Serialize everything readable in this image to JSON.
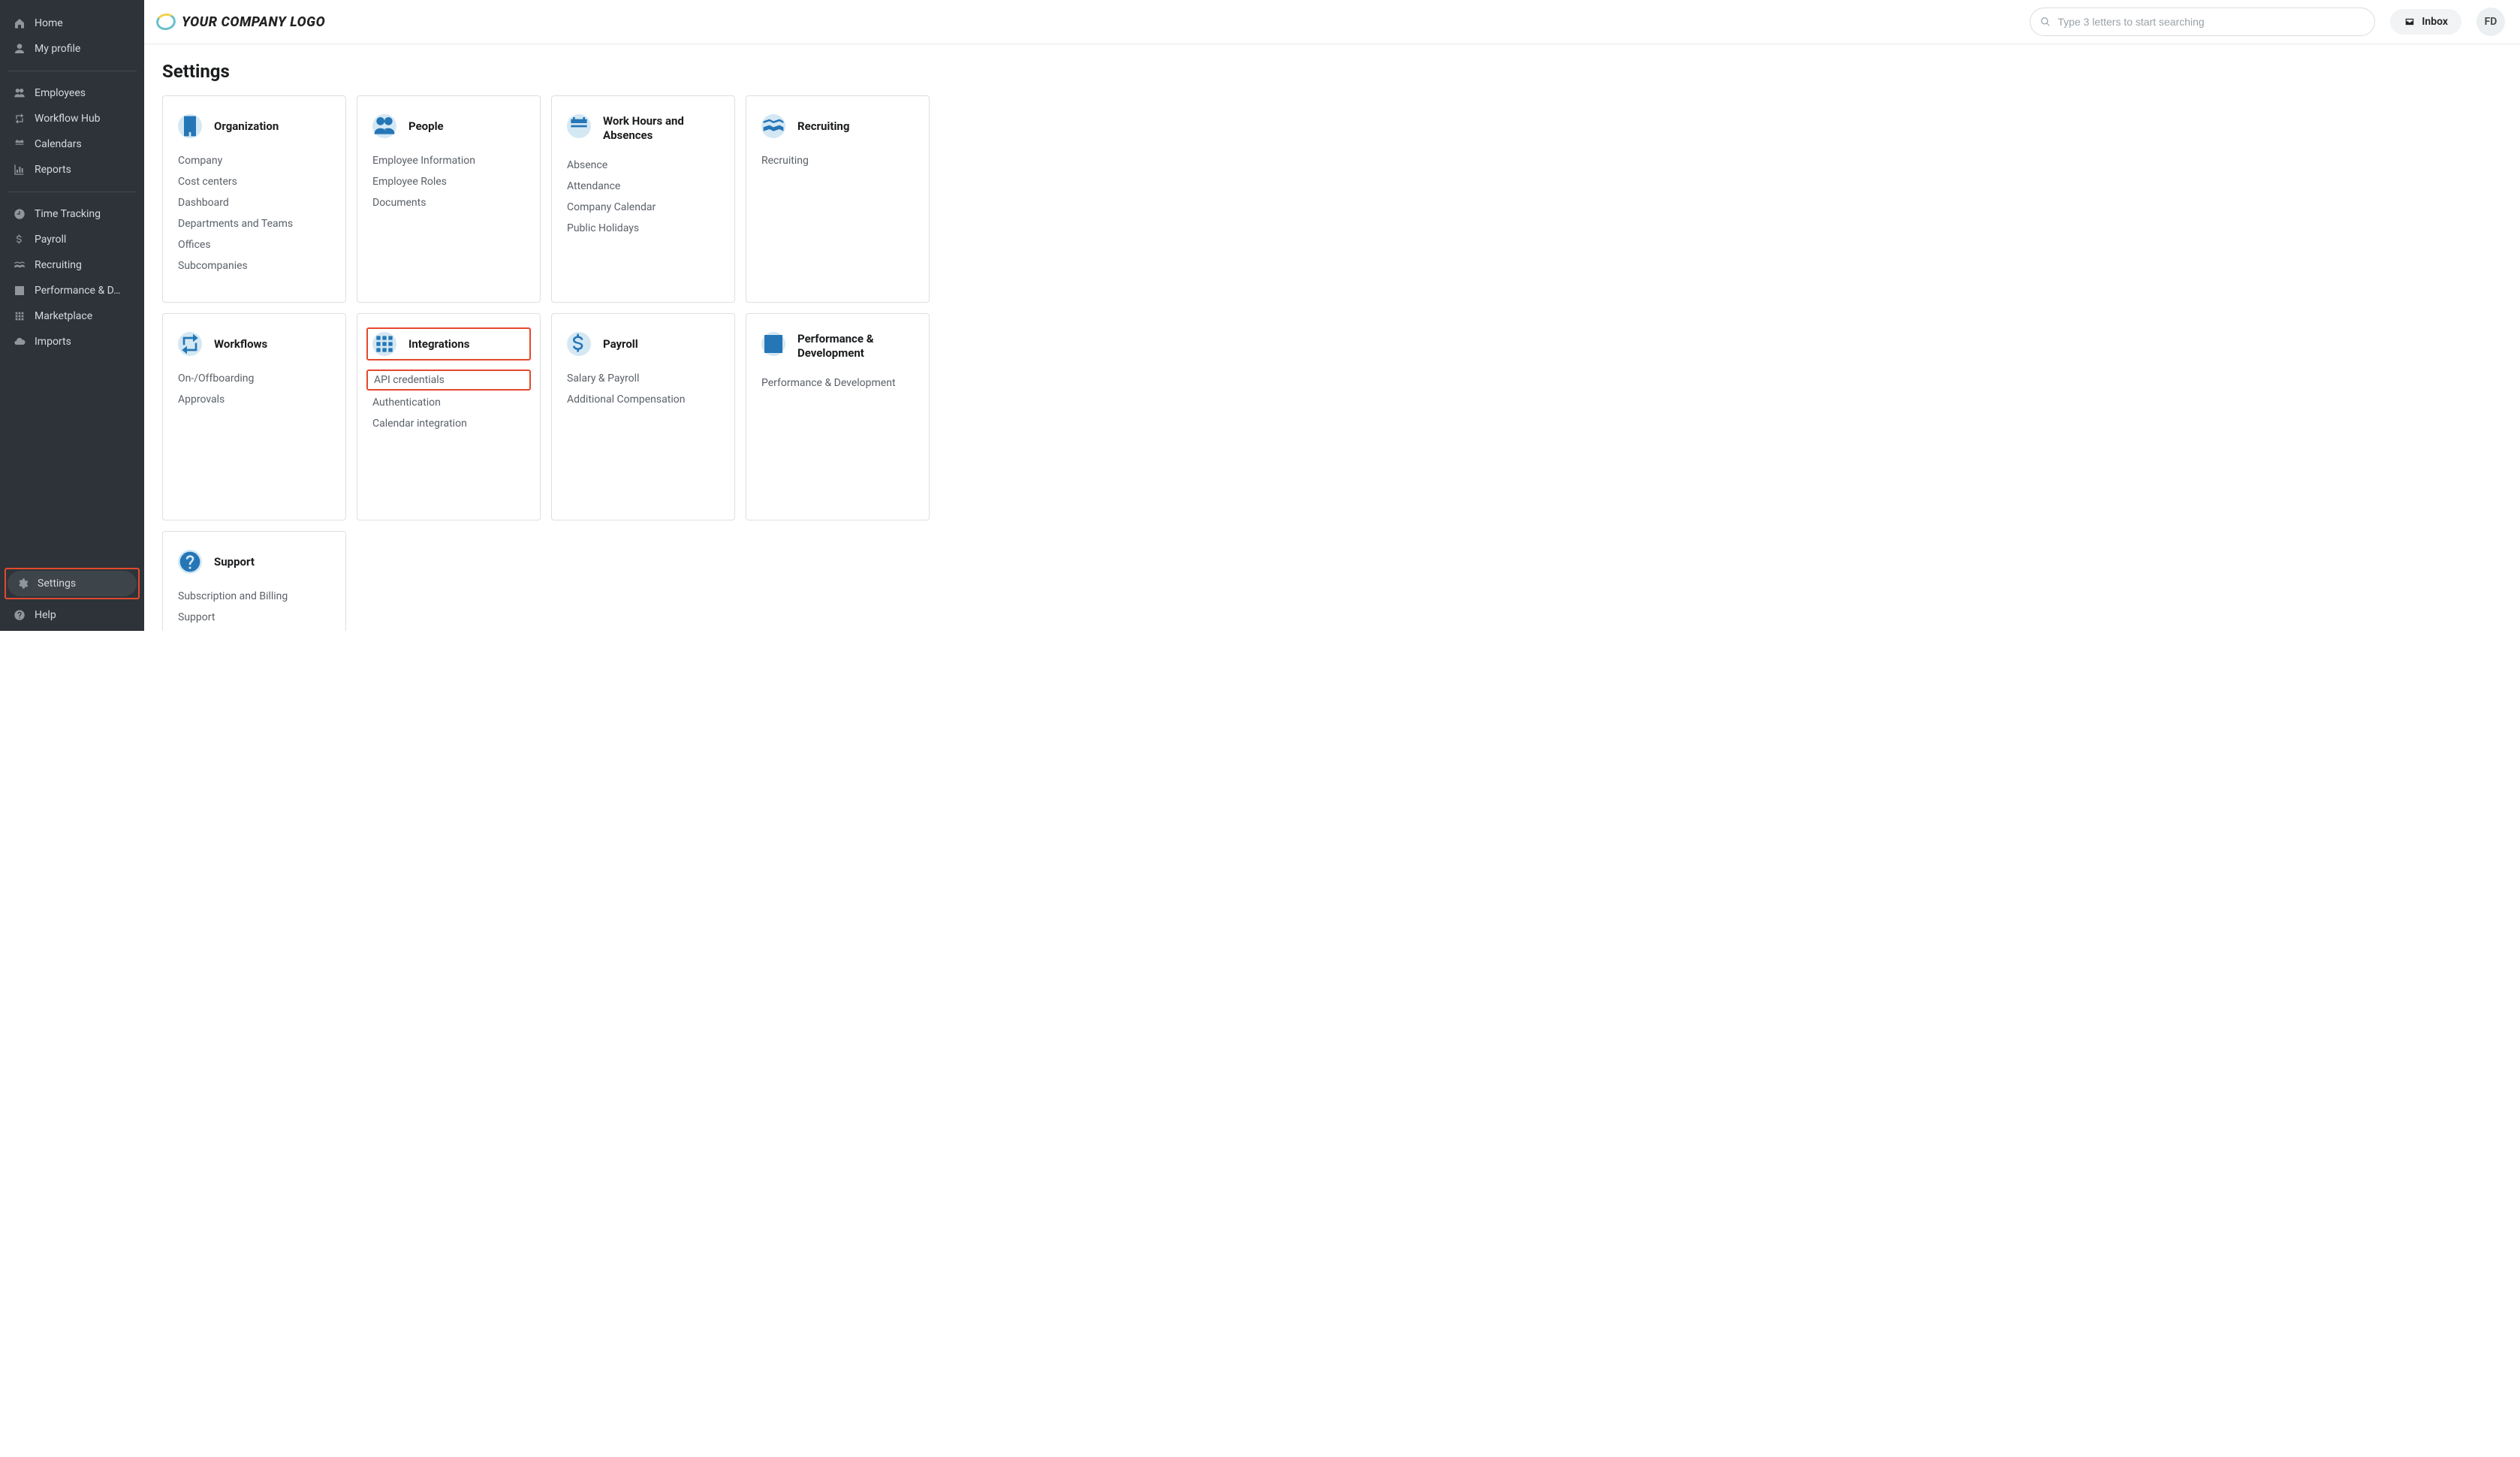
{
  "logo_text": "YOUR COMPANY LOGO",
  "search_placeholder": "Type 3 letters to start searching",
  "inbox_label": "Inbox",
  "avatar_initials": "FD",
  "page_title": "Settings",
  "sidebar": {
    "top": [
      {
        "icon": "home",
        "label": "Home"
      },
      {
        "icon": "user",
        "label": "My profile"
      }
    ],
    "group1": [
      {
        "icon": "users",
        "label": "Employees"
      },
      {
        "icon": "retweet",
        "label": "Workflow Hub"
      },
      {
        "icon": "cal",
        "label": "Calendars"
      },
      {
        "icon": "chart",
        "label": "Reports"
      }
    ],
    "group2": [
      {
        "icon": "clock",
        "label": "Time Tracking"
      },
      {
        "icon": "dollar",
        "label": "Payroll"
      },
      {
        "icon": "hand",
        "label": "Recruiting"
      },
      {
        "icon": "perf",
        "label": "Performance & D…"
      },
      {
        "icon": "grid",
        "label": "Marketplace"
      },
      {
        "icon": "cloud",
        "label": "Imports"
      }
    ],
    "bottom": [
      {
        "icon": "gear",
        "label": "Settings",
        "active": true,
        "highlight": true
      },
      {
        "icon": "question",
        "label": "Help"
      }
    ]
  },
  "cards": [
    {
      "icon": "building",
      "title": "Organization",
      "links": [
        "Company",
        "Cost centers",
        "Dashboard",
        "Departments and Teams",
        "Offices",
        "Subcompanies"
      ]
    },
    {
      "icon": "users",
      "title": "People",
      "links": [
        "Employee Information",
        "Employee Roles",
        "Documents"
      ]
    },
    {
      "icon": "cal",
      "title": "Work Hours and Absences",
      "links": [
        "Absence",
        "Attendance",
        "Company Calendar",
        "Public Holidays"
      ]
    },
    {
      "icon": "hand",
      "title": "Recruiting",
      "links": [
        "Recruiting"
      ]
    },
    {
      "icon": "retweet",
      "title": "Workflows",
      "links": [
        "On-/Offboarding",
        "Approvals"
      ]
    },
    {
      "icon": "grid",
      "title": "Integrations",
      "highlight": true,
      "links": [
        "API credentials",
        "Authentication",
        "Calendar integration"
      ],
      "link_highlight": 0
    },
    {
      "icon": "dollar",
      "title": "Payroll",
      "links": [
        "Salary & Payroll",
        "Additional Compensation"
      ]
    },
    {
      "icon": "perf",
      "title": "Performance & Development",
      "links": [
        "Performance & Development"
      ]
    },
    {
      "icon": "question",
      "title": "Support",
      "links": [
        "Subscription and Billing",
        "Support"
      ]
    }
  ]
}
